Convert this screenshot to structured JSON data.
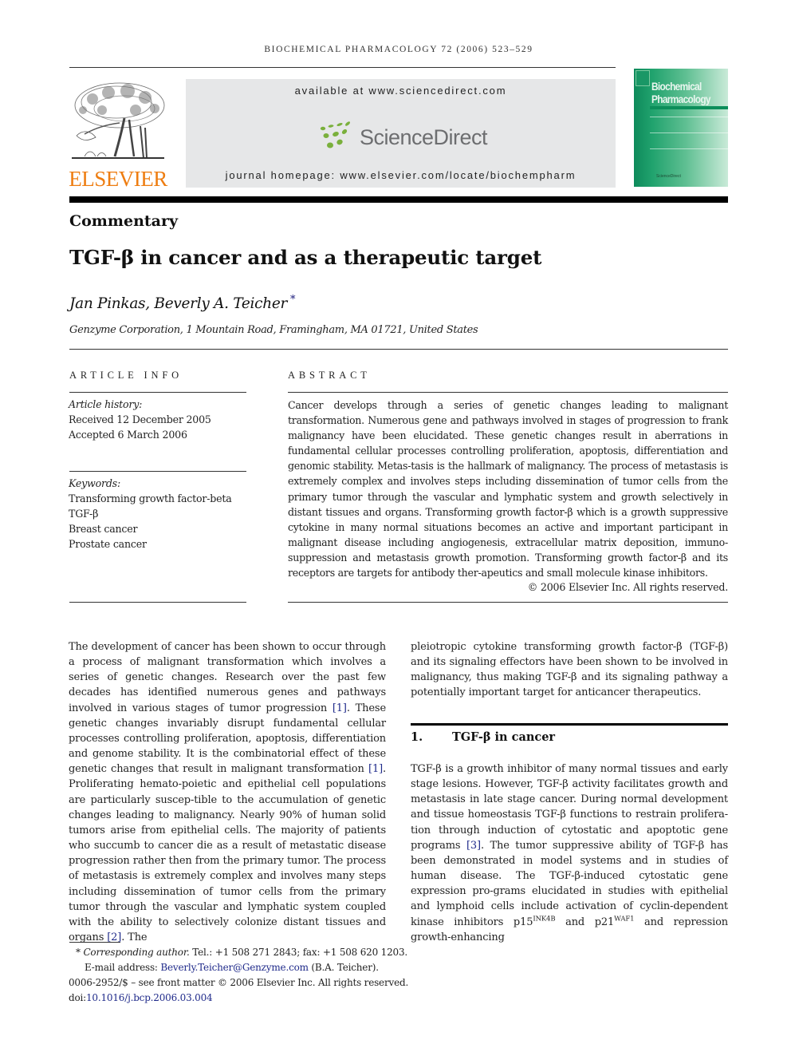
{
  "journal_header": {
    "running_head": "BIOCHEMICAL PHARMACOLOGY 72 (2006) 523–529",
    "publisher_logo_text": "ELSEVIER",
    "publisher_logo_color": "#ee7d11",
    "available_at": "available at www.sciencedirect.com",
    "sciencedirect_logo_text": "ScienceDirect",
    "sciencedirect_accent": "#7ab03c",
    "journal_homepage": "journal homepage: www.elsevier.com/locate/biochempharm",
    "cover": {
      "title_line1": "Biochemical",
      "title_line2": "Pharmacology",
      "footer_text": "ScienceDirect",
      "color": "#0e8a5b"
    }
  },
  "article": {
    "type": "Commentary",
    "title": "TGF-β in cancer and as a therapeutic target",
    "authors": "Jan Pinkas, Beverly A. Teicher",
    "author_mark": "*",
    "affiliation": "Genzyme Corporation, 1 Mountain Road, Framingham, MA 01721, United States"
  },
  "article_info": {
    "heading": "ARTICLE INFO",
    "history_label": "Article history:",
    "received": "Received 12 December 2005",
    "accepted": "Accepted 6 March 2006",
    "keywords_label": "Keywords:",
    "keywords": [
      "Transforming growth factor-beta",
      "TGF-β",
      "Breast cancer",
      "Prostate cancer"
    ]
  },
  "abstract": {
    "heading": "ABSTRACT",
    "text": "Cancer develops through a series of genetic changes leading to malignant transformation. Numerous gene and pathways involved in stages of progression to frank malignancy have been elucidated. These genetic changes result in aberrations in fundamental cellular processes controlling proliferation, apoptosis, differentiation and genomic stability. Metas-tasis is the hallmark of malignancy. The process of metastasis is extremely complex and involves steps including dissemination of tumor cells from the primary tumor through the vascular and lymphatic system and growth selectively in distant tissues and organs. Transforming growth factor-β which is a growth suppressive cytokine in many normal situations becomes an active and important participant in malignant disease including angiogenesis, extracellular matrix deposition, immuno-suppression and metastasis growth promotion. Transforming growth factor-β and its receptors are targets for antibody ther-apeutics and small molecule kinase inhibitors.",
    "copyright": "© 2006 Elsevier Inc. All rights reserved."
  },
  "body": {
    "left_column": {
      "p1_a": "The development of cancer has been shown to occur through a process of malignant transformation which involves a series of genetic changes. Research over the past few decades has identified numerous genes and pathways involved in various stages of tumor progression ",
      "cite1": "[1]",
      "p1_b": ". These genetic changes invariably disrupt fundamental cellular processes controlling proliferation, apoptosis, differentiation and genome stability. It is the combinatorial effect of these genetic changes that result in malignant transformation ",
      "cite2": "[1]",
      "p1_c": ". Proliferating hemato-poietic and epithelial cell populations are particularly suscep-tible to the accumulation of genetic changes leading to malignancy. Nearly 90% of human solid tumors arise from epithelial cells. The majority of patients who succumb to cancer die as a result of metastatic disease progression rather then from the primary tumor. The process of metastasis is extremely complex and involves many steps including dissemination of tumor cells from the primary tumor through the vascular and lymphatic system coupled with the ability to selectively colonize distant tissues and organs ",
      "cite3": "[2]",
      "p1_d": ". The"
    },
    "right_column": {
      "p1": "pleiotropic cytokine transforming growth factor-β (TGF-β) and its signaling effectors have been shown to be involved in malignancy, thus making TGF-β and its signaling pathway a potentially important target for anticancer therapeutics.",
      "section_number": "1.",
      "section_title": "TGF-β in cancer",
      "p2_a": "TGF-β is a growth inhibitor of many normal tissues and early stage lesions. However, TGF-β activity facilitates growth and metastasis in late stage cancer. During normal development and tissue homeostasis TGF-β functions to restrain prolifera-tion through induction of cytostatic and apoptotic gene programs ",
      "cite4": "[3]",
      "p2_b": ". The tumor suppressive ability of TGF-β has been demonstrated in model systems and in studies of human disease. The TGF-β-induced cytostatic gene expression pro-grams elucidated in studies with epithelial and lymphoid cells include activation of cyclin-dependent kinase inhibitors p15",
      "sup1": "INK4B",
      "p2_c": " and p21",
      "sup2": "WAF1",
      "p2_d": " and repression growth-enhancing"
    }
  },
  "footnotes": {
    "star": "*",
    "corresponding_label": "Corresponding author.",
    "contact": " Tel.: +1 508 271 2843; fax: +1 508 620 1203.",
    "email_label": "E-mail address: ",
    "email": "Beverly.Teicher@Genzyme.com",
    "email_suffix": " (B.A. Teicher).",
    "issn_line": "0006-2952/$ – see front matter © 2006 Elsevier Inc. All rights reserved.",
    "doi_label": "doi:",
    "doi": "10.1016/j.bcp.2006.03.004"
  }
}
